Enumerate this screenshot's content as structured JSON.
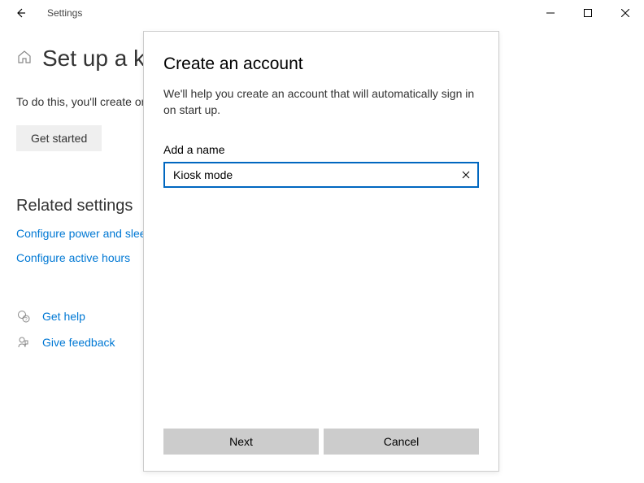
{
  "titlebar": {
    "title": "Settings"
  },
  "page": {
    "title": "Set up a kiosk",
    "body": "To do this, you'll create or choose an account and the only app that it can use (",
    "getStartedLabel": "Get started"
  },
  "related": {
    "heading": "Related settings",
    "links": [
      "Configure power and sleep",
      "Configure active hours"
    ]
  },
  "help": {
    "items": [
      "Get help",
      "Give feedback"
    ]
  },
  "dialog": {
    "title": "Create an account",
    "description": "We'll help you create an account that will automatically sign in on start up.",
    "fieldLabel": "Add a name",
    "nameValue": "Kiosk mode",
    "nextLabel": "Next",
    "cancelLabel": "Cancel"
  }
}
